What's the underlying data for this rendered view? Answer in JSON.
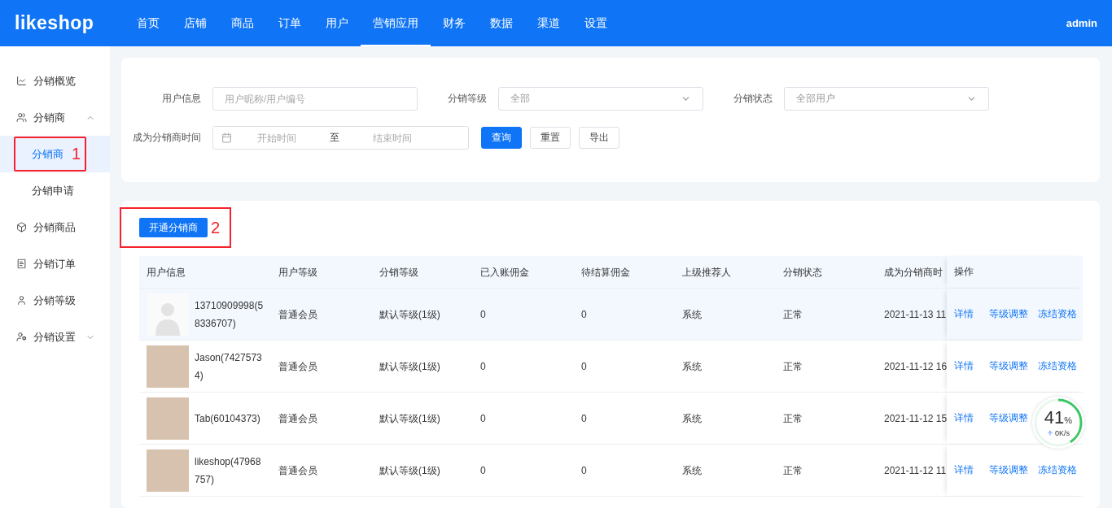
{
  "header": {
    "logo": "likeshop",
    "nav": [
      {
        "label": "首页",
        "selected": false
      },
      {
        "label": "店铺",
        "selected": false
      },
      {
        "label": "商品",
        "selected": false
      },
      {
        "label": "订单",
        "selected": false
      },
      {
        "label": "用户",
        "selected": false
      },
      {
        "label": "营销应用",
        "selected": true
      },
      {
        "label": "财务",
        "selected": false
      },
      {
        "label": "数据",
        "selected": false
      },
      {
        "label": "渠道",
        "selected": false
      },
      {
        "label": "设置",
        "selected": false
      }
    ],
    "user": "admin"
  },
  "sidebar": {
    "items": [
      {
        "label": "分销概览",
        "selected": false
      },
      {
        "label": "分销商",
        "selected": false,
        "expanded": true,
        "children": [
          {
            "label": "分销商",
            "selected": true,
            "annotation": "1"
          },
          {
            "label": "分销申请",
            "selected": false
          }
        ]
      },
      {
        "label": "分销商品",
        "selected": false
      },
      {
        "label": "分销订单",
        "selected": false
      },
      {
        "label": "分销等级",
        "selected": false
      },
      {
        "label": "分销设置",
        "selected": false,
        "expanded": false
      }
    ]
  },
  "filters": {
    "user_info": {
      "label": "用户信息",
      "placeholder": "用户昵称/用户编号"
    },
    "level": {
      "label": "分销等级",
      "value": "全部"
    },
    "status": {
      "label": "分销状态",
      "value": "全部用户"
    },
    "time": {
      "label": "成为分销商时间",
      "start_placeholder": "开始时间",
      "separator": "至",
      "end_placeholder": "结束时间"
    },
    "buttons": [
      {
        "label": "查询",
        "kind": "primary"
      },
      {
        "label": "重置",
        "kind": "plain"
      },
      {
        "label": "导出",
        "kind": "plain"
      }
    ]
  },
  "open_button": {
    "label": "开通分销商",
    "annotation": "2"
  },
  "table": {
    "columns": [
      "用户信息",
      "用户等级",
      "分销等级",
      "已入账佣金",
      "待结算佣金",
      "上级推荐人",
      "分销状态",
      "成为分销商时",
      "操作"
    ],
    "rows": [
      {
        "kind": "default",
        "user": "13710909998(58336707)",
        "user_level": "普通会员",
        "dist_level": "默认等级(1级)",
        "settled": "0",
        "pending": "0",
        "referrer": "系统",
        "status": "正常",
        "time": "2021-11-13 11",
        "actions": [
          "详情",
          "等级调整",
          "冻结资格"
        ],
        "selected": true
      },
      {
        "kind": "photo",
        "user": "Jason(74275734)",
        "user_level": "普通会员",
        "dist_level": "默认等级(1级)",
        "settled": "0",
        "pending": "0",
        "referrer": "系统",
        "status": "正常",
        "time": "2021-11-12 16",
        "actions": [
          "详情",
          "等级调整",
          "冻结资格"
        ],
        "selected": false
      },
      {
        "kind": "photo",
        "user": "Tab(60104373)",
        "user_level": "普通会员",
        "dist_level": "默认等级(1级)",
        "settled": "0",
        "pending": "0",
        "referrer": "系统",
        "status": "正常",
        "time": "2021-11-12 15",
        "actions": [
          "详情",
          "等级调整"
        ],
        "selected": false
      },
      {
        "kind": "photo",
        "user": "likeshop(47968757)",
        "user_level": "普通会员",
        "dist_level": "默认等级(1级)",
        "settled": "0",
        "pending": "0",
        "referrer": "系统",
        "status": "正常",
        "time": "2021-11-12 11",
        "actions": [
          "详情",
          "等级调整",
          "冻结资格"
        ],
        "selected": false
      }
    ]
  },
  "speed_widget": {
    "percent": "41",
    "unit": "%",
    "speed": "0K/s",
    "level": 0.41
  }
}
